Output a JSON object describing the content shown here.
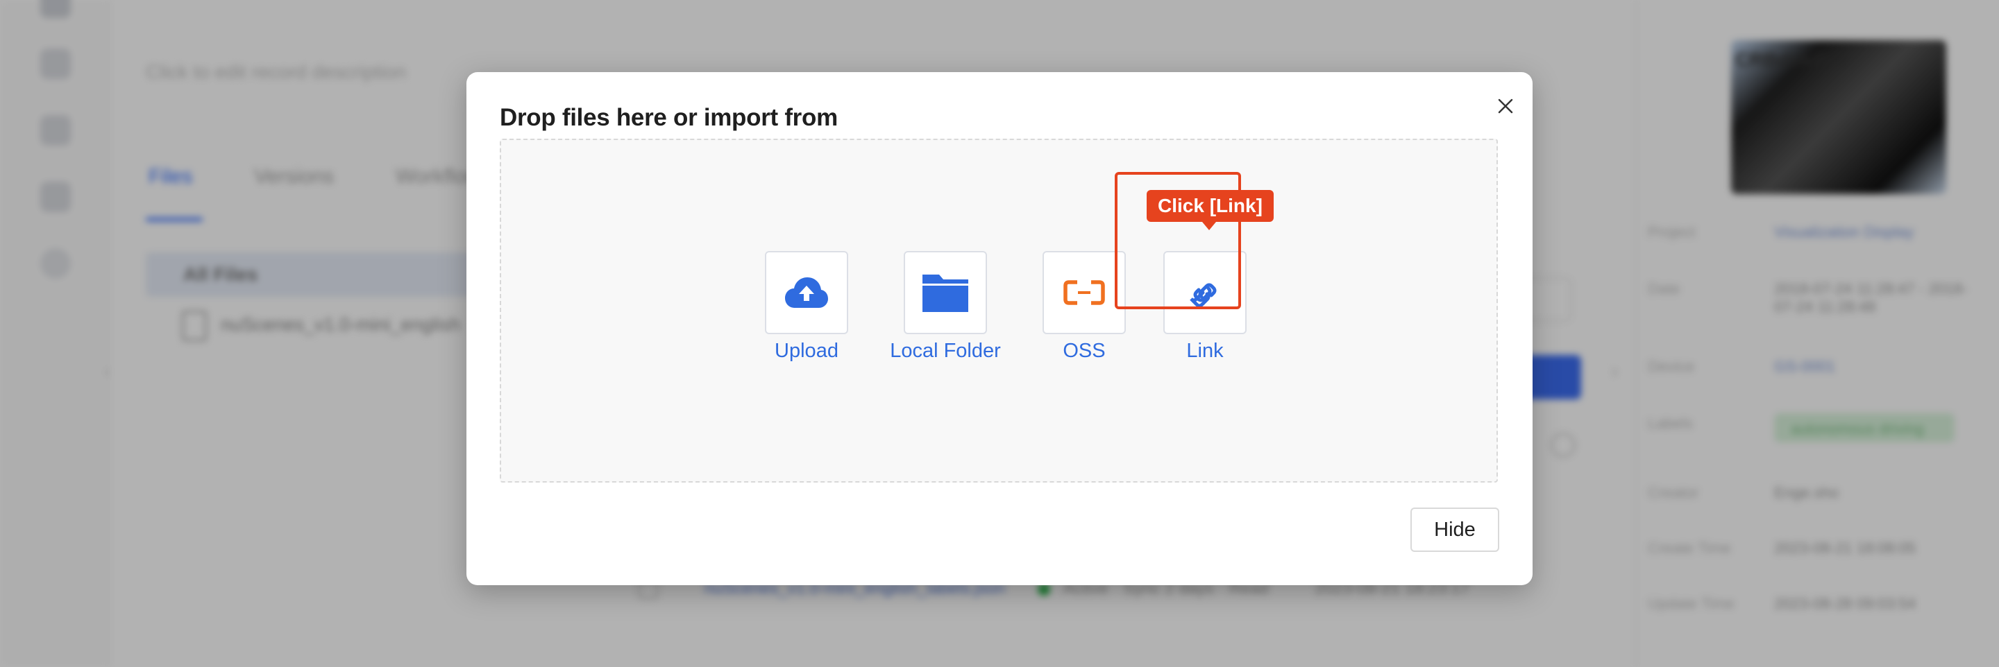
{
  "background": {
    "record_description_placeholder": "Click to edit record description",
    "tabs": [
      {
        "label": "Files",
        "active": true
      },
      {
        "label": "Versions",
        "active": false
      },
      {
        "label": "Workflows",
        "active": false
      }
    ],
    "all_files_label": "All Files",
    "file_name": "nuScenes_v1.0-mini_english",
    "table_row": {
      "file": "nuScenes_v1.0-mini_english_labels.json",
      "status": "Active · Sync 2 days · Read",
      "time": "2023-08-21 18:23:17"
    },
    "side_panel": {
      "thumbnail_caption": "CRBdskdsh",
      "fields": [
        {
          "key": "Project",
          "value": "Visualization Display"
        },
        {
          "key": "Date",
          "value": "2018-07-24 11:28:47 - 2018-07-24 11:28:48"
        },
        {
          "key": "Device",
          "value": "GS-0001"
        },
        {
          "key": "Labels",
          "value": "autonomous driving"
        },
        {
          "key": "Creator",
          "value": "Enge.sho"
        },
        {
          "key": "Create Time",
          "value": "2023-08-21 18:08:05"
        },
        {
          "key": "Update Time",
          "value": "2023-08-28 09:03:54"
        }
      ]
    }
  },
  "modal": {
    "title": "Drop files here or import from",
    "close_icon": "close-icon",
    "sources": [
      {
        "label": "Upload",
        "icon": "cloud-upload-icon"
      },
      {
        "label": "Local Folder",
        "icon": "folder-icon"
      },
      {
        "label": "OSS",
        "icon": "oss-icon"
      },
      {
        "label": "Link",
        "icon": "link-icon"
      }
    ],
    "hide_label": "Hide"
  },
  "annotation": {
    "tooltip": "Click [Link]",
    "color": "#e6431e"
  },
  "colors": {
    "accent": "#2f6bdf",
    "oss_orange": "#f07020",
    "highlight": "#e6431e"
  }
}
